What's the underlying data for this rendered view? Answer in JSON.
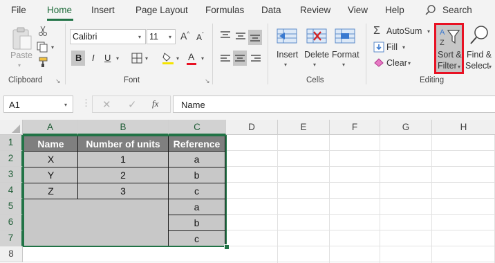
{
  "tabs": [
    "File",
    "Home",
    "Insert",
    "Page Layout",
    "Formulas",
    "Data",
    "Review",
    "View",
    "Help"
  ],
  "search_label": "Search",
  "clipboard": {
    "paste_label": "Paste",
    "group_label": "Clipboard"
  },
  "font": {
    "font_name": "Calibri",
    "font_size": "11",
    "bold": "B",
    "italic": "I",
    "underline": "U",
    "grow": "A",
    "shrink": "A",
    "font_color_glyph": "A",
    "group_label": "Font"
  },
  "cells": {
    "insert_label": "Insert",
    "delete_label": "Delete",
    "format_label": "Format",
    "group_label": "Cells"
  },
  "editing": {
    "autosum_label": "AutoSum",
    "fill_label": "Fill",
    "clear_label": "Clear",
    "sort_label_1": "Sort &",
    "sort_label_2": "Filter",
    "find_label_1": "Find &",
    "find_label_2": "Select",
    "group_label": "Editing"
  },
  "formula_bar": {
    "name_box": "A1",
    "fx": "fx",
    "content": "Name"
  },
  "columns": [
    "A",
    "B",
    "C",
    "D",
    "E",
    "F",
    "G",
    "H"
  ],
  "rows": [
    "1",
    "2",
    "3",
    "4",
    "5",
    "6",
    "7",
    "8"
  ],
  "table": {
    "headers": [
      "Name",
      "Number of units",
      "Reference"
    ],
    "col_a": [
      "X",
      "Y",
      "Z"
    ],
    "col_b": [
      "1",
      "2",
      "3"
    ],
    "col_c": [
      "a",
      "b",
      "c",
      "a",
      "b",
      "c"
    ]
  },
  "colors": {
    "accent": "#217346",
    "highlight": "#e81123",
    "header_fill": "#7f7f7f",
    "data_fill": "#c8c8c8"
  }
}
